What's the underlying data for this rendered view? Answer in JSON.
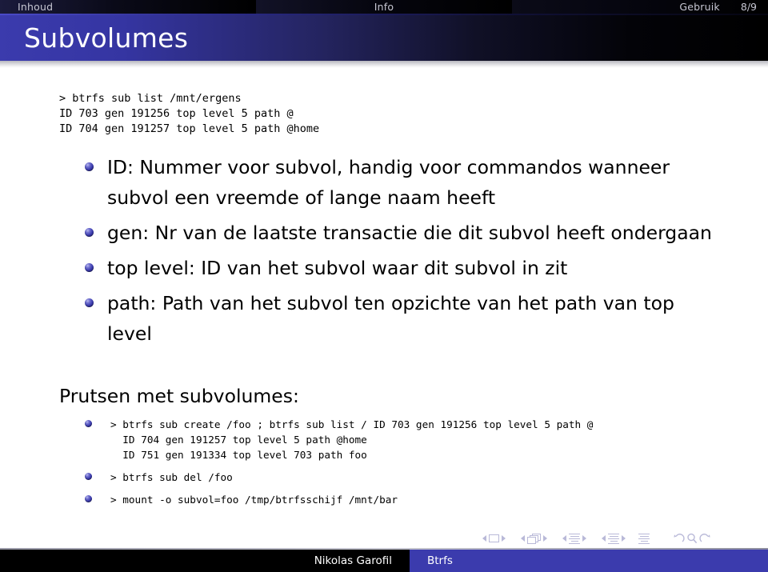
{
  "headbar": {
    "sections": [
      {
        "label": "Inhoud"
      },
      {
        "label": "Info"
      },
      {
        "label": "Gebruik"
      }
    ],
    "frame_counter": "8/9"
  },
  "title": "Subvolumes",
  "terminal_block": "> btrfs sub list /mnt/ergens\nID 703 gen 191256 top level 5 path @\nID 704 gen 191257 top level 5 path @home",
  "itemize": [
    {
      "text": "ID: Nummer voor subvol, handig voor commandos wanneer subvol een vreemde of lange naam heeft"
    },
    {
      "text": "gen: Nr van de laatste transactie die dit subvol heeft ondergaan"
    },
    {
      "text": "top level: ID van het subvol waar dit subvol in zit"
    },
    {
      "text": "path: Path van het subvol ten opzichte van het path van top level"
    }
  ],
  "block": {
    "title": "Prutsen met subvolumes:",
    "items": [
      {
        "code": "> btrfs sub create /foo ; btrfs sub list / ID 703 gen 191256 top level 5 path @\n  ID 704 gen 191257 top level 5 path @home\n  ID 751 gen 191334 top level 703 path foo"
      },
      {
        "code": "> btrfs sub del /foo"
      },
      {
        "code": "> mount -o subvol=foo /tmp/btrfsschijf /mnt/bar"
      }
    ]
  },
  "navigation_symbols": [
    {
      "name": "previous-slide",
      "icon": "triangle-left-icon"
    },
    {
      "name": "slide-indicator",
      "icon": "slide-icon"
    },
    {
      "name": "next-slide",
      "icon": "triangle-right-icon"
    },
    {
      "name": "previous-frame",
      "icon": "triangle-left-icon"
    },
    {
      "name": "frame-indicator",
      "icon": "frames-icon"
    },
    {
      "name": "next-frame",
      "icon": "triangle-right-icon"
    },
    {
      "name": "previous-subsection",
      "icon": "triangle-left-icon"
    },
    {
      "name": "subsection-indicator",
      "icon": "document-icon"
    },
    {
      "name": "next-subsection",
      "icon": "triangle-right-icon"
    },
    {
      "name": "previous-section",
      "icon": "triangle-left-icon"
    },
    {
      "name": "section-indicator",
      "icon": "document-icon"
    },
    {
      "name": "next-section",
      "icon": "triangle-right-icon"
    },
    {
      "name": "presentation-indicator",
      "icon": "document-icon"
    },
    {
      "name": "go-back",
      "icon": "undo-arrow-icon"
    },
    {
      "name": "search",
      "icon": "magnifier-icon"
    },
    {
      "name": "go-forward",
      "icon": "redo-arrow-icon"
    }
  ],
  "footer": {
    "author": "Nikolas Garofil",
    "subject": "Btrfs"
  },
  "colors": {
    "accent_blue": "#3b3bad",
    "headbar_text": "#c6c6d2",
    "nav_symbol": "#b9b9d8",
    "background": "#ffffff"
  }
}
